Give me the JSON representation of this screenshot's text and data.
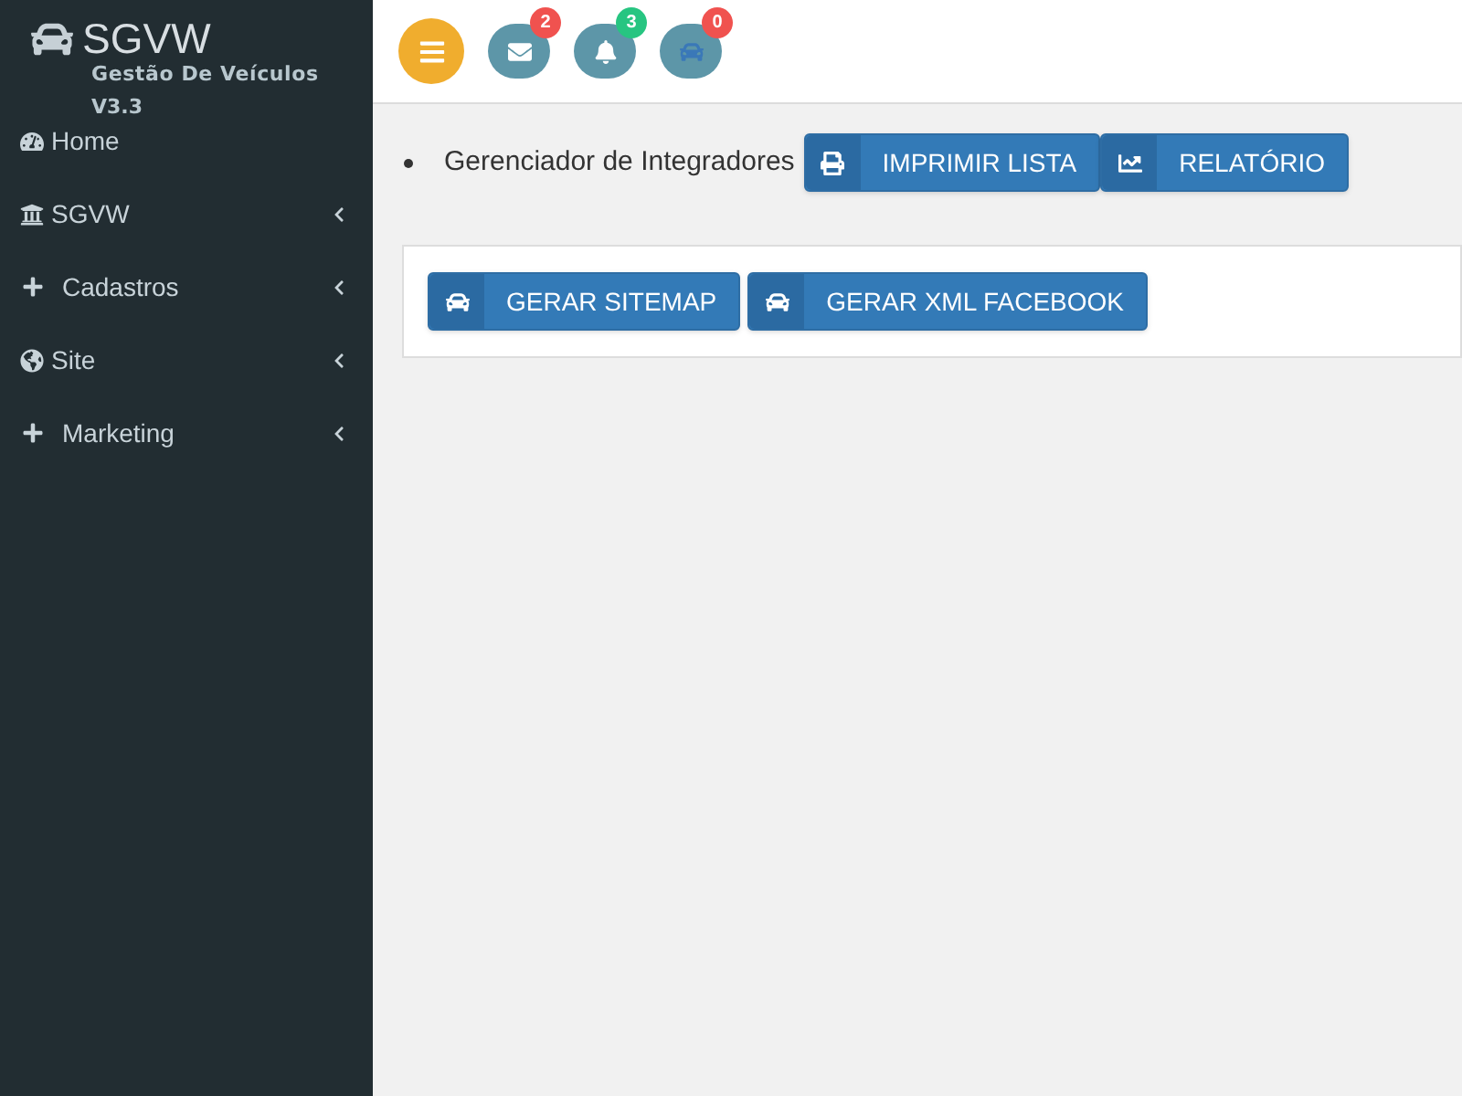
{
  "brand": {
    "title": "SGVW",
    "subtitle": "Gestão De Veículos",
    "version": "V3.3"
  },
  "sidebar": {
    "items": [
      {
        "label": "Home",
        "kind": "link"
      },
      {
        "label": "SGVW",
        "kind": "menu"
      },
      {
        "label": "Cadastros",
        "kind": "menu"
      },
      {
        "label": "Site",
        "kind": "menu"
      },
      {
        "label": "Marketing",
        "kind": "menu"
      }
    ]
  },
  "topbar": {
    "notifications": [
      {
        "count": "2",
        "color": "#f0524f"
      },
      {
        "count": "3",
        "color": "#27c581"
      },
      {
        "count": "0",
        "color": "#f0524f"
      }
    ]
  },
  "breadcrumb": {
    "label": "Gerenciador de Integradores",
    "buttons": [
      "IMPRIMIR LISTA",
      "RELATÓRIO"
    ]
  },
  "panel": {
    "buttons": [
      "GERAR SITEMAP",
      "GERAR XML FACEBOOK"
    ]
  }
}
